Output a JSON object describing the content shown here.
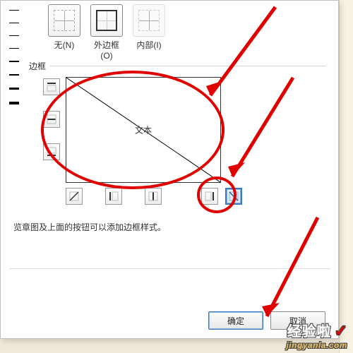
{
  "presets": {
    "none": "无(N)",
    "outer": "外边框(O)",
    "inner": "内部(I)"
  },
  "section": {
    "border_label": "边框"
  },
  "preview": {
    "text": "文本"
  },
  "hint": "览章图及上面的按钮可以添加边框样式。",
  "buttons": {
    "ok": "确定",
    "cancel": "取消"
  },
  "watermark": {
    "main": "经验啦",
    "check": "✓",
    "sub": "jingyanla.com"
  },
  "colors": {
    "accent": "#3a7abd",
    "annotation": "#e00000"
  }
}
